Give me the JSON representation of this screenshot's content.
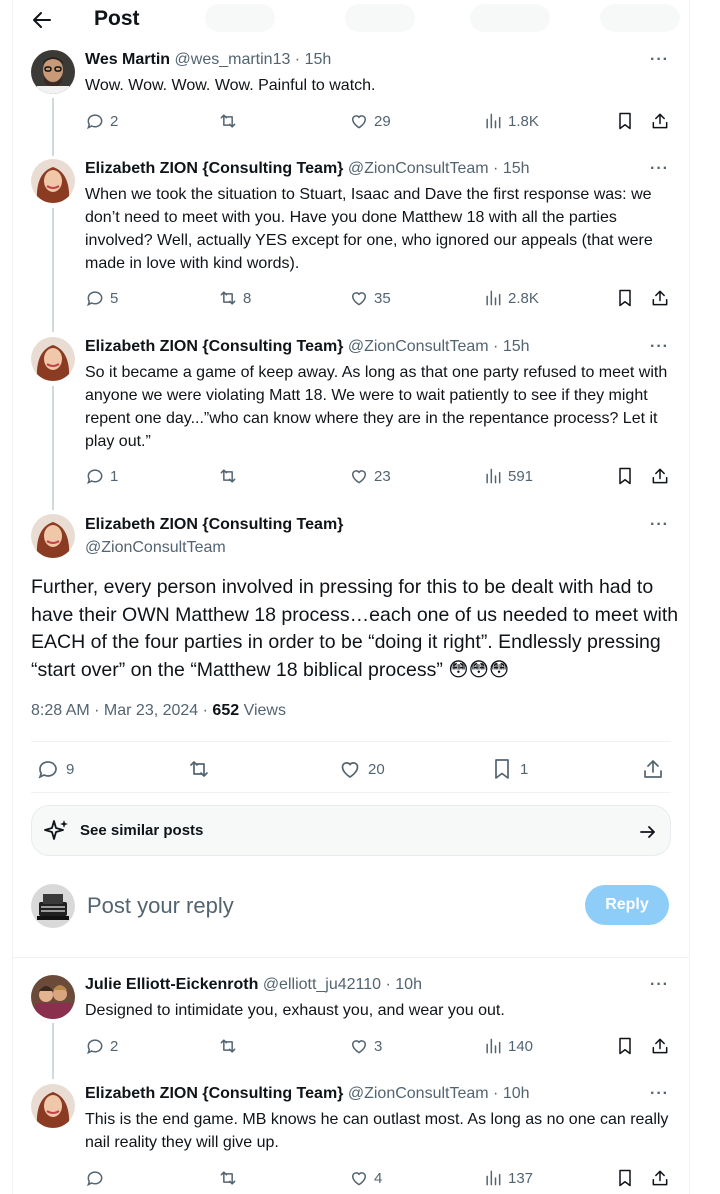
{
  "header": {
    "title": "Post"
  },
  "thread": [
    {
      "name": "Wes Martin",
      "handle": "@wes_martin13",
      "time": "15h",
      "text": "Wow. Wow. Wow. Wow. Painful to watch.",
      "replies": "2",
      "reposts": "",
      "likes": "29",
      "views": "1.8K"
    },
    {
      "name": "Elizabeth ZION {Consulting Team}",
      "handle": "@ZionConsultTeam",
      "time": "15h",
      "text": "When we took the situation to Stuart, Isaac and Dave the first response was: we don’t need to meet with you. Have you done Matthew 18 with all the parties involved? Well, actually YES except for one, who ignored our appeals (that were made in love with kind words).",
      "replies": "5",
      "reposts": "8",
      "likes": "35",
      "views": "2.8K"
    },
    {
      "name": "Elizabeth ZION {Consulting Team}",
      "handle": "@ZionConsultTeam",
      "time": "15h",
      "text": "So it became a game of keep away. As long as that one party refused to meet with anyone we were violating Matt 18. We were to wait patiently to see if they might repent one day...”who can know where they are in the repentance process? Let it play out.”",
      "replies": "1",
      "reposts": "",
      "likes": "23",
      "views": "591"
    }
  ],
  "main_post": {
    "name": "Elizabeth ZION {Consulting Team}",
    "handle": "@ZionConsultTeam",
    "text": "Further, every person involved in pressing for this to be dealt with had to have their OWN Matthew 18 process…each one of us needed to meet with EACH of the four parties in order to be “doing it right”. Endlessly pressing “start over” on the “Matthew 18 biblical process” 😳😳😳",
    "timestamp": "8:28 AM · Mar 23, 2024 · ",
    "views_count": "652",
    "views_label": " Views",
    "replies": "9",
    "reposts": "",
    "likes": "20",
    "bookmarks": "1"
  },
  "similar": {
    "label": "See similar posts"
  },
  "reply_box": {
    "placeholder": "Post your reply",
    "button": "Reply"
  },
  "replies": [
    {
      "name": "Julie Elliott-Eickenroth",
      "handle": "@elliott_ju42110",
      "time": "10h",
      "text": "Designed to intimidate you, exhaust you, and wear you out.",
      "replies": "2",
      "reposts": "",
      "likes": "3",
      "views": "140"
    },
    {
      "name": "Elizabeth ZION {Consulting Team}",
      "handle": "@ZionConsultTeam",
      "time": "10h",
      "text": "This is the end game. MB knows he can outlast most. As long as no one can really nail reality they will give up.",
      "replies": "",
      "reposts": "",
      "likes": "4",
      "views": "137"
    }
  ],
  "colors": {
    "accent": "#1d9bf0",
    "reply_button": "#8ecdf7",
    "muted": "#536471"
  }
}
